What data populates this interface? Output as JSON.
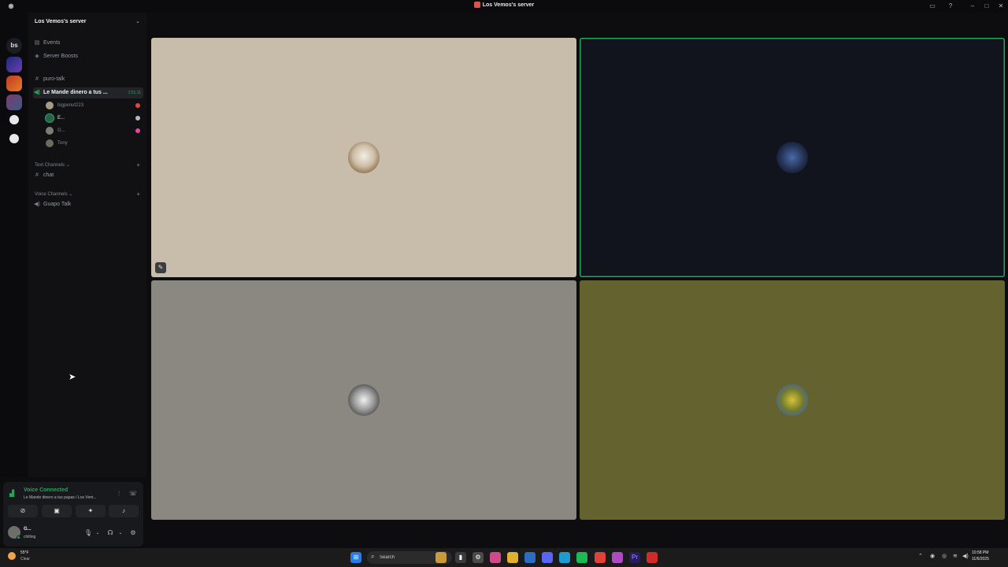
{
  "window": {
    "title": "Los Vemos's server"
  },
  "rail": {
    "home_label": "bs"
  },
  "server": {
    "name": "Los Vemos's server"
  },
  "sidebar": {
    "events": "Events",
    "boosts": "Server Boosts",
    "channels": [
      {
        "label": "puro-talk"
      },
      {
        "label": "Le Mande dinero a tus ...",
        "timer": "2:51:11"
      }
    ],
    "voice_users": [
      {
        "name": "bigpenut223",
        "color": "#ed4245"
      },
      {
        "name": "E...",
        "color": "#b5bac1"
      },
      {
        "name": "G...",
        "color": "#eb459f"
      },
      {
        "name": "Tony",
        "color": ""
      }
    ],
    "text_category": "Text Channels",
    "text_channels": [
      {
        "label": "chat"
      }
    ],
    "voice_category": "Voice Channels",
    "voice_channels": [
      {
        "label": "Guapo Talk"
      }
    ]
  },
  "voice_panel": {
    "status": "Voice Connected",
    "channel": "Le Mande dinero a tus papas / Los Vem..."
  },
  "user": {
    "name": "G...",
    "status": "chilling"
  },
  "tiles": [
    {
      "bg": "#c8bcab",
      "speaking": false
    },
    {
      "bg": "#12141d",
      "speaking": true
    },
    {
      "bg": "#8a8881",
      "speaking": false
    },
    {
      "bg": "#64632f",
      "speaking": false
    }
  ],
  "taskbar": {
    "weather_temp": "55°F",
    "weather_desc": "Clear",
    "search_placeholder": "Search",
    "time": "10:58 PM",
    "date": "11/6/2025"
  },
  "colors": {
    "accent_green": "#23a55a",
    "sidebar_bg": "#111114"
  }
}
